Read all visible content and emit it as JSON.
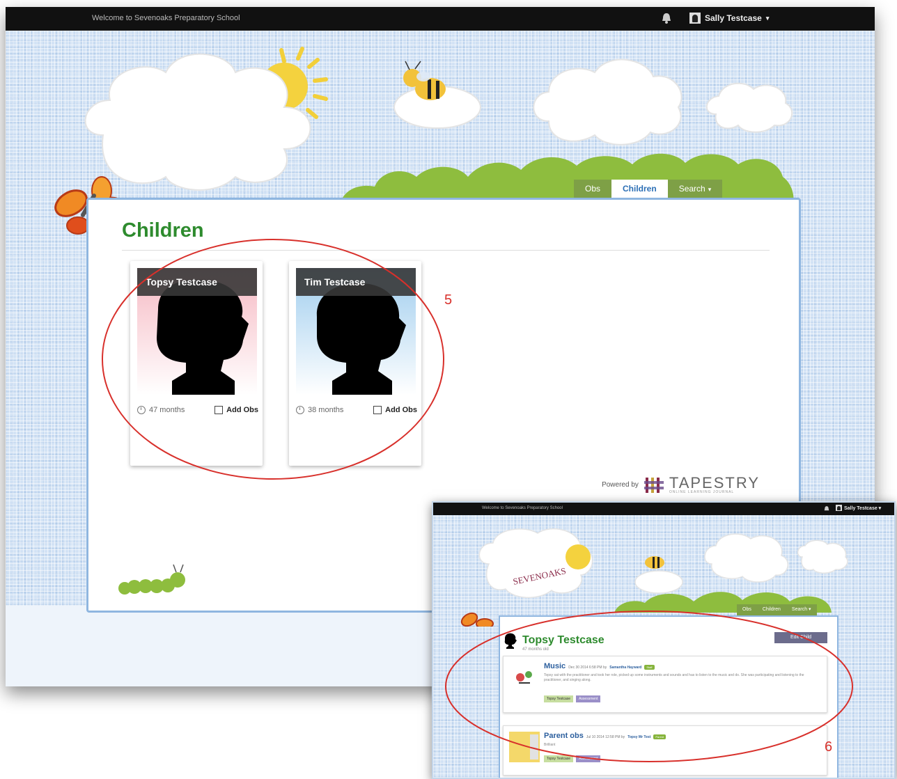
{
  "main": {
    "topbar": {
      "welcome": "Welcome to Sevenoaks Preparatory School",
      "user_name": "Sally Testcase",
      "user_caret": "▾"
    },
    "nav": {
      "tabs": [
        {
          "label": "Obs"
        },
        {
          "label": "Children"
        },
        {
          "label": "Search"
        }
      ],
      "search_caret": "▾"
    },
    "page_title": "Children",
    "children": [
      {
        "name": "Topsy Testcase",
        "age": "47 months",
        "add_obs": "Add Obs"
      },
      {
        "name": "Tim Testcase",
        "age": "38 months",
        "add_obs": "Add Obs"
      }
    ],
    "powered_by": "Powered by",
    "brand": {
      "name": "TAPESTRY",
      "tagline": "ONLINE LEARNING JOURNAL"
    },
    "annotation": "5"
  },
  "inset": {
    "topbar": {
      "welcome": "Welcome to Sevenoaks Preparatory School",
      "user_name": "Sally Testcase ▾"
    },
    "school_logo": "SEVENOAKS",
    "nav": {
      "tabs": [
        {
          "label": "Obs"
        },
        {
          "label": "Children"
        },
        {
          "label": "Search ▾"
        }
      ]
    },
    "child": {
      "name": "Topsy Testcase",
      "age": "47 months old",
      "edit_label": "Edit Child"
    },
    "observations": [
      {
        "title": "Music",
        "date": "Dec 30 2014 6:58 PM by",
        "author": "Samantha Hayward",
        "badge": "Staff",
        "text": "Topsy sat with the practitioner and took her role, picked up some instruments and sounds and has to listen to the music and do. She was participating and listening to the practitioner, and singing along.",
        "tag_child": "Topsy Testcase",
        "tag_area": "Assessment"
      },
      {
        "title": "Parent obs",
        "date": "Jul 10 2014 12:58 PM by",
        "author": "Topsy Mr Test",
        "badge": "Parent",
        "text": "Brilliant",
        "tag_child": "Topsy Testcase",
        "tag_area": "Assessment"
      }
    ],
    "annotation": "6"
  },
  "colors": {
    "topbar_bg": "#111111",
    "page_title_green": "#2e8b2e",
    "nav_green": "#7ea046",
    "panel_border": "#8fb6e0",
    "annotation_red": "#d8302b",
    "link_blue": "#2c5f9e"
  },
  "icons": [
    "bell-icon",
    "user-avatar-icon",
    "clock-icon",
    "checkbox-icon",
    "caret-down-icon"
  ]
}
